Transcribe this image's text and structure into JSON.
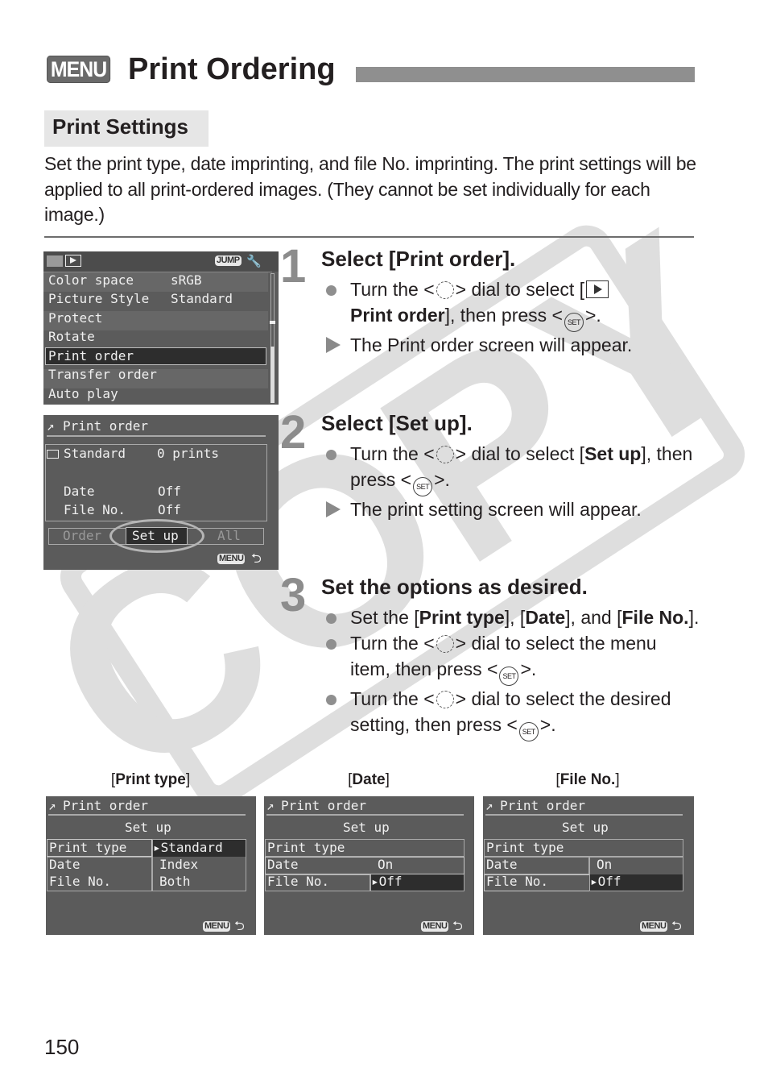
{
  "header": {
    "badge": "MENU",
    "title": "Print Ordering"
  },
  "section": {
    "title": "Print Settings",
    "intro": "Set the print type, date imprinting, and file No. imprinting. The print settings will be applied to all print-ordered images. (They cannot be set individually for each image.)"
  },
  "watermark": "COPY",
  "steps": [
    {
      "number": "1",
      "heading": "Select [Print order].",
      "b1": {
        "pre": "Turn the <",
        "mid": "> dial to select [",
        "bold": "Print order",
        "mid2": "], then press <",
        "post": ">."
      },
      "result": "The Print order screen will appear."
    },
    {
      "number": "2",
      "heading": "Select [Set up].",
      "b1": {
        "pre": "Turn the <",
        "mid": "> dial to select [",
        "bold": "Set up",
        "mid2": "], then press <",
        "post": ">."
      },
      "result": "The print setting screen will appear."
    },
    {
      "number": "3",
      "heading": "Set the options as desired.",
      "b1": {
        "pre": "Set the [",
        "bold1": "Print type",
        "mid1": "], [",
        "bold2": "Date",
        "mid2": "], and [",
        "bold3": "File No.",
        "post": "]."
      },
      "b2": {
        "pre": "Turn the <",
        "mid": "> dial to select the menu item, then press <",
        "post": ">."
      },
      "b3": {
        "pre": "Turn the <",
        "mid": "> dial to select the desired setting, then press <",
        "post": ">."
      }
    }
  ],
  "icons": {
    "set": "SET"
  },
  "screen1": {
    "jump": "JUMP",
    "items": [
      {
        "label": "Color space",
        "value": "sRGB"
      },
      {
        "label": "Picture Style",
        "value": "Standard"
      },
      {
        "label": "Protect",
        "value": ""
      },
      {
        "label": "Rotate",
        "value": ""
      },
      {
        "label": "Print order",
        "value": "",
        "selected": true
      },
      {
        "label": "Transfer order",
        "value": ""
      },
      {
        "label": "Auto play",
        "value": ""
      }
    ]
  },
  "screen2": {
    "title": "Print order",
    "print_type": "Standard",
    "prints": "0 prints",
    "date_label": "Date",
    "date_value": "Off",
    "file_label": "File No.",
    "file_value": "Off",
    "buttons": [
      "Order",
      "Set up",
      "All"
    ],
    "selected_button": "Set up",
    "menu": "MENU"
  },
  "setup_screens": [
    {
      "caption_pre": "[",
      "caption": "Print type",
      "caption_post": "]",
      "title": "Print order",
      "subtitle": "Set up",
      "rows": [
        "Print type",
        "Date",
        "File No."
      ],
      "options": [
        "▸Standard",
        "Index",
        "Both"
      ],
      "selected_option": "Standard",
      "menu": "MENU"
    },
    {
      "caption_pre": "[",
      "caption": "Date",
      "caption_post": "]",
      "title": "Print order",
      "subtitle": "Set up",
      "rows": [
        "Print type",
        "Date",
        "File No."
      ],
      "options": [
        "On",
        "▸Off"
      ],
      "selected_option": "Off",
      "menu": "MENU"
    },
    {
      "caption_pre": "[",
      "caption": "File No.",
      "caption_post": "]",
      "title": "Print order",
      "subtitle": "Set up",
      "rows": [
        "Print type",
        "Date",
        "File No."
      ],
      "options": [
        "On",
        "▸Off"
      ],
      "selected_option": "Off",
      "menu": "MENU"
    }
  ],
  "page_number": "150"
}
